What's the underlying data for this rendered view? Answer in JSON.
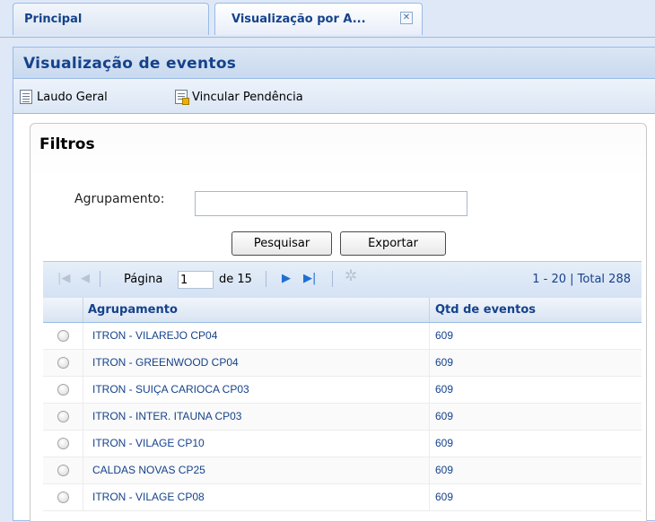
{
  "tabs": [
    {
      "label": "Principal"
    },
    {
      "label": "Visualização por A...",
      "closable": true
    }
  ],
  "panel": {
    "title": "Visualização de eventos"
  },
  "toolbar": {
    "laudo_label": "Laudo Geral",
    "vincular_label": "Vincular Pendência"
  },
  "filtros": {
    "title": "Filtros",
    "agrupamento_label": "Agrupamento:",
    "agrupamento_value": "",
    "pesquisar_label": "Pesquisar",
    "exportar_label": "Exportar"
  },
  "pager": {
    "pagina_label": "Página",
    "page_value": "1",
    "of_label": "de 15",
    "summary": "1 - 20 | Total 288"
  },
  "grid": {
    "columns": [
      "Agrupamento",
      "Qtd de eventos"
    ],
    "rows": [
      {
        "agrupamento": "ITRON - VILAREJO CP04",
        "qtd": "609"
      },
      {
        "agrupamento": "ITRON - GREENWOOD CP04",
        "qtd": "609"
      },
      {
        "agrupamento": "ITRON - SUIÇA CARIOCA CP03",
        "qtd": "609"
      },
      {
        "agrupamento": "ITRON - INTER. ITAUNA CP03",
        "qtd": "609"
      },
      {
        "agrupamento": "ITRON - VILAGE CP10",
        "qtd": "609"
      },
      {
        "agrupamento": "CALDAS NOVAS CP25",
        "qtd": "609"
      },
      {
        "agrupamento": "ITRON - VILAGE CP08",
        "qtd": "609"
      }
    ]
  },
  "colors": {
    "accent": "#15428b",
    "border": "#99bbe8",
    "background": "#dfe8f6"
  },
  "icons": [
    "close-icon",
    "document-icon",
    "document-link-icon",
    "first-page-icon",
    "prev-page-icon",
    "next-page-icon",
    "last-page-icon",
    "refresh-icon"
  ]
}
